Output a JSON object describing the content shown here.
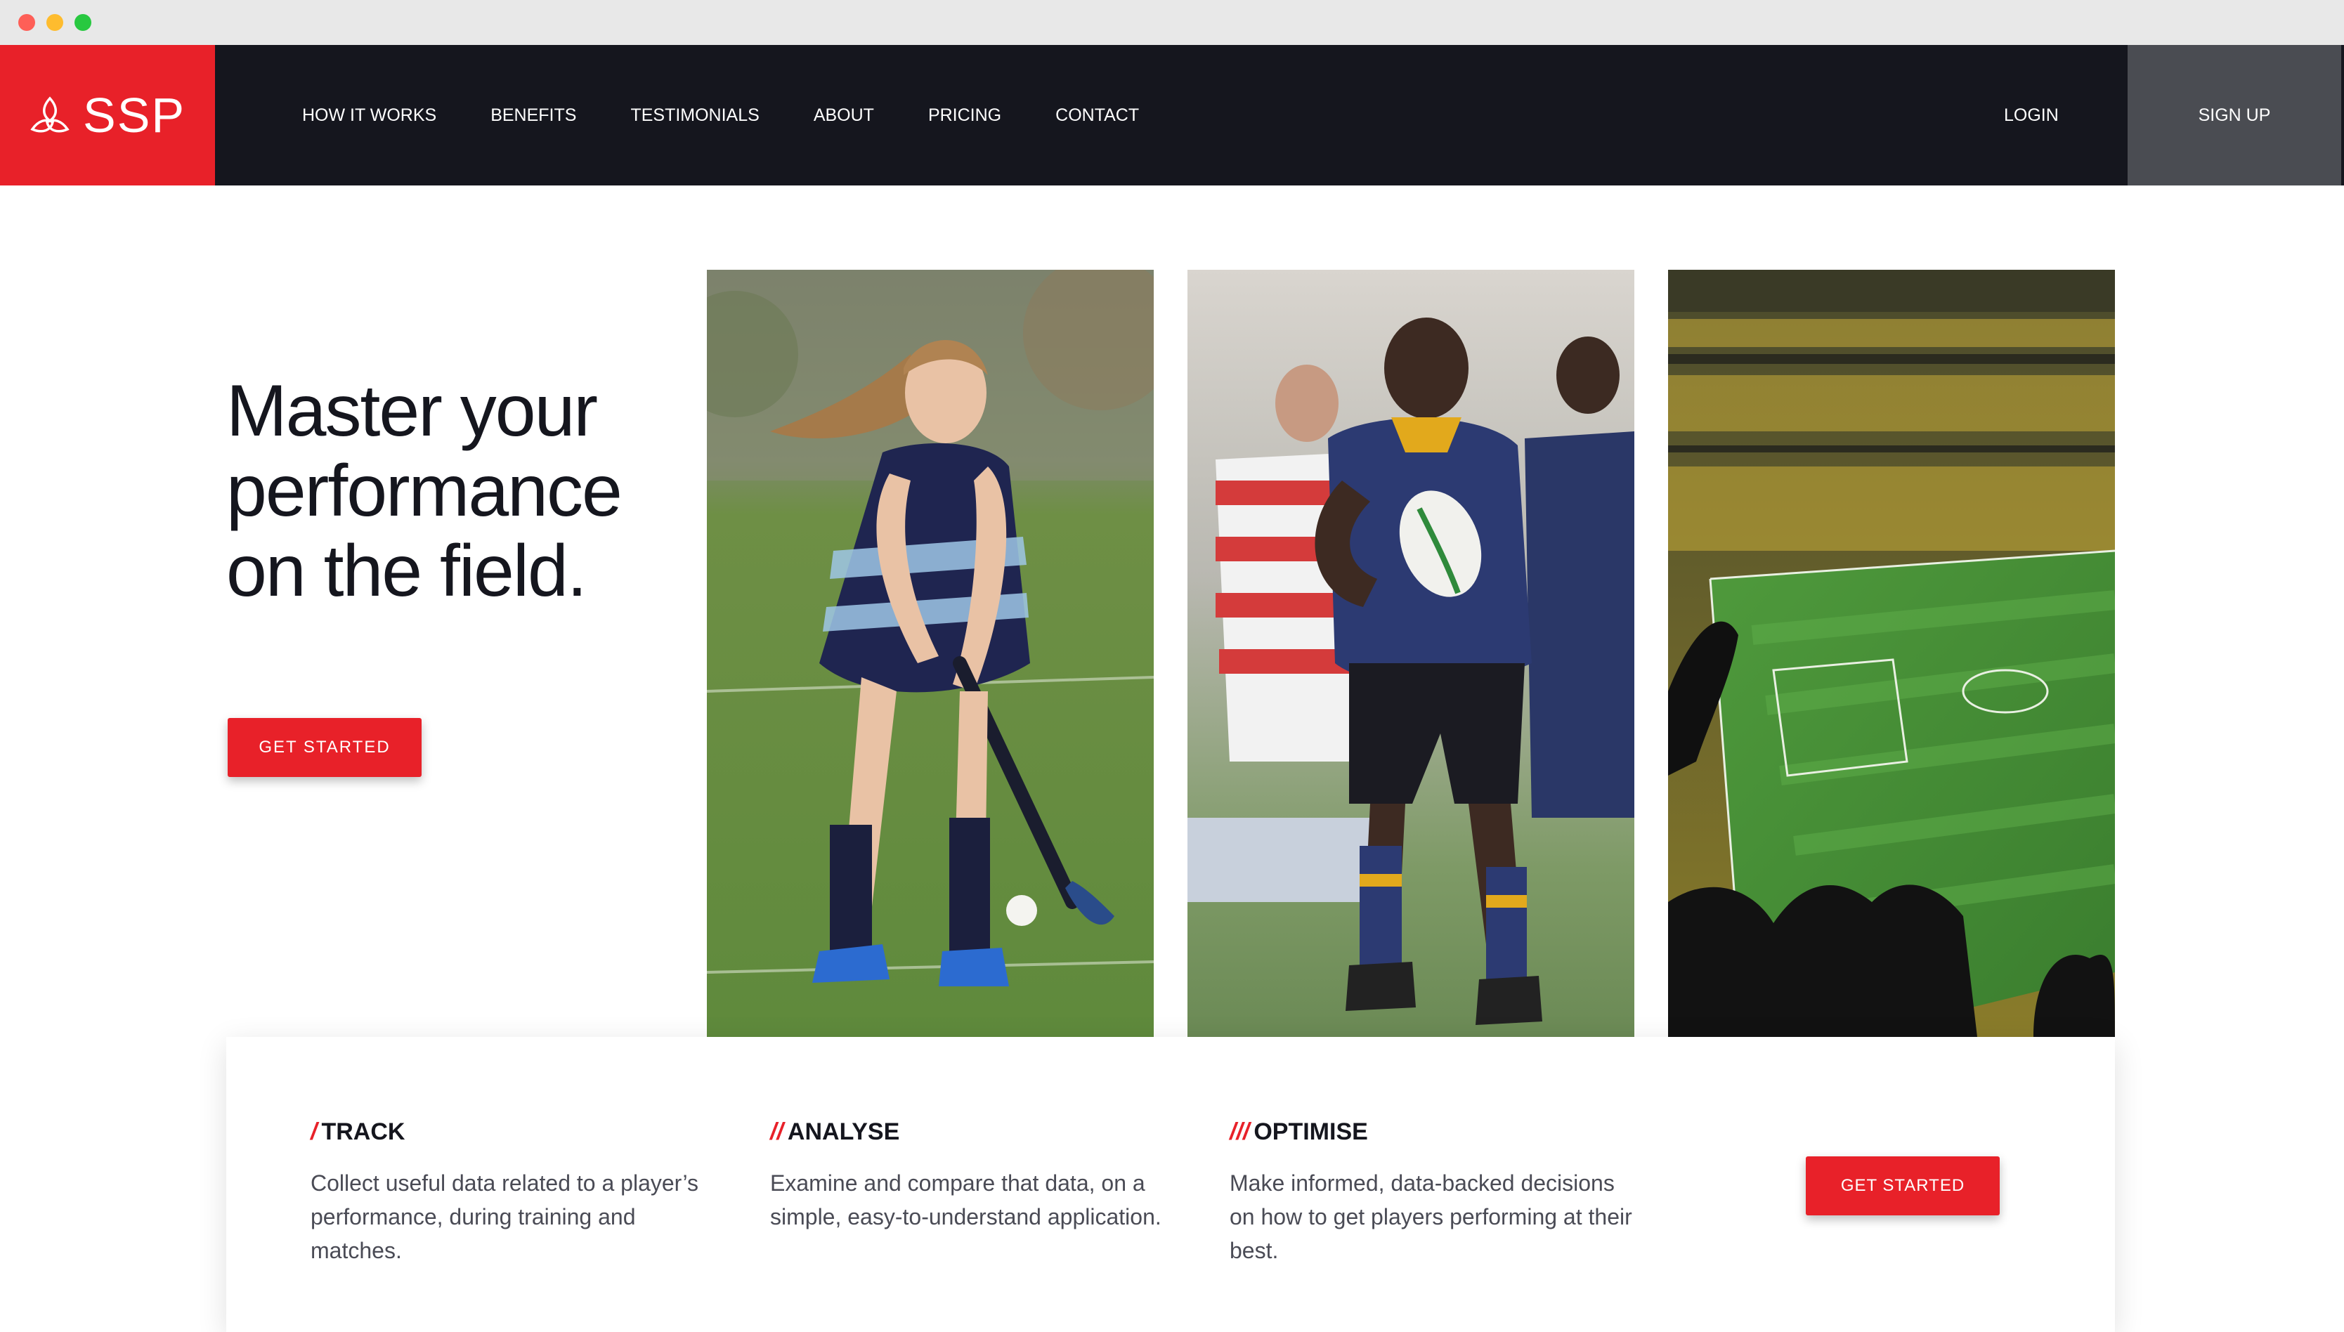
{
  "brand": {
    "name": "SSP",
    "color": "#e82129"
  },
  "nav": {
    "links": [
      "HOW IT WORKS",
      "BENEFITS",
      "TESTIMONIALS",
      "ABOUT",
      "PRICING",
      "CONTACT"
    ],
    "login": "LOGIN",
    "signup": "SIGN UP"
  },
  "hero": {
    "title_line1": "Master your",
    "title_line2": "performance",
    "title_line3": "on the field.",
    "cta": "GET STARTED",
    "photos": [
      "hockey-player-photo",
      "rugby-player-photo",
      "stadium-photo"
    ]
  },
  "features": [
    {
      "slash": "/",
      "title": "TRACK",
      "desc": "Collect useful data related to a player’s performance, during training and matches."
    },
    {
      "slash": "//",
      "title": "ANALYSE",
      "desc": "Examine and compare that data, on a simple, easy-to-understand application."
    },
    {
      "slash": "///",
      "title": "OPTIMISE",
      "desc": "Make informed, data-backed decisions on how to get players performing at their best."
    }
  ],
  "card_cta": "GET STARTED"
}
